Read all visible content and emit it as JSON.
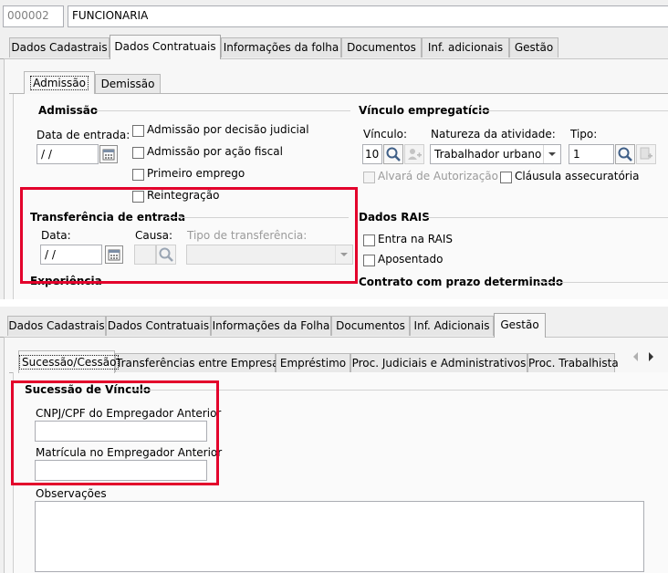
{
  "top": {
    "code": "000002",
    "name": "FUNCIONARIA"
  },
  "tabs1": [
    "Dados Cadastrais",
    "Dados Contratuais",
    "Informações da folha",
    "Documentos",
    "Inf. adicionais",
    "Gestão"
  ],
  "subtabs1": [
    "Admissão",
    "Demissão"
  ],
  "admissao": {
    "section": "Admissão",
    "data_entrada_label": "Data de entrada:",
    "data_entrada_value": " / /",
    "checks": [
      "Admissão por decisão judicial",
      "Admissão por ação fiscal",
      "Primeiro emprego",
      "Reintegração"
    ]
  },
  "vinculo": {
    "section": "Vínculo empregatício",
    "vinculo_label": "Vínculo:",
    "vinculo_value": "10",
    "natureza_label": "Natureza da atividade:",
    "natureza_value": "Trabalhador urbano",
    "tipo_label": "Tipo:",
    "tipo_value": "1",
    "alvara": "Alvará de Autorização",
    "clausula": "Cláusula assecuratória"
  },
  "transferencia": {
    "section": "Transferência de entrada",
    "data_label": "Data:",
    "data_value": " / /",
    "causa_label": "Causa:",
    "tipo_label": "Tipo de transferência:"
  },
  "rais": {
    "section": "Dados RAIS",
    "entra": "Entra na RAIS",
    "aposentado": "Aposentado"
  },
  "cut": {
    "experiencia": "Experiência",
    "contrato": "Contrato com prazo determinado"
  },
  "tabs2": [
    "Dados Cadastrais",
    "Dados Contratuais",
    "Informações da Folha",
    "Documentos",
    "Inf. Adicionais",
    "Gestão"
  ],
  "subtabs2": [
    "Sucessão/Cessão",
    "Transferências entre Empresas",
    "Empréstimo",
    "Proc. Judiciais e Administrativos",
    "Proc. Trabalhista"
  ],
  "sucessao": {
    "section": "Sucessão de Vínculo",
    "cnpj_label": "CNPJ/CPF do Empregador Anterior",
    "cnpj_value": "",
    "matricula_label": "Matrícula no Empregador Anterior",
    "matricula_value": "",
    "obs_label": "Observações"
  },
  "colors": {
    "highlight": "#e3002b",
    "window_bg": "#f0f0f0",
    "border": "#abadb3"
  }
}
